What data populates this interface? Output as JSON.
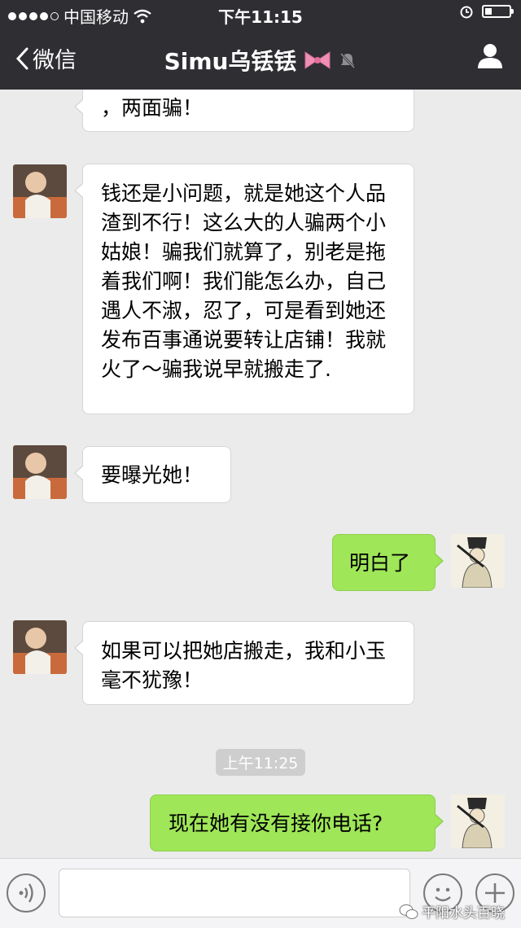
{
  "status_bar": {
    "carrier": "中国移动",
    "time": "下午11:15",
    "battery_level": 0.3
  },
  "nav": {
    "back_label": "微信",
    "title": "Simu乌铥铥"
  },
  "messages": [
    {
      "side": "left",
      "text": "，两面骗！"
    },
    {
      "side": "left",
      "text": "钱还是小问题，就是她这个人品渣到不行！这么大的人骗两个小姑娘！骗我们就算了，别老是拖着我们啊！我们能怎么办，自己遇人不淑，忍了，可是看到她还发布百事通说要转让店铺！我就火了～骗我说早就搬走了."
    },
    {
      "side": "left",
      "text": "要曝光她！"
    },
    {
      "side": "right",
      "text": "明白了"
    },
    {
      "side": "left",
      "text": "如果可以把她店搬走，我和小玉毫不犹豫！"
    },
    {
      "side": "right",
      "text": "现在她有没有接你电话?"
    }
  ],
  "timestamp": "上午11:25",
  "watermark": "平阳水头百晓"
}
